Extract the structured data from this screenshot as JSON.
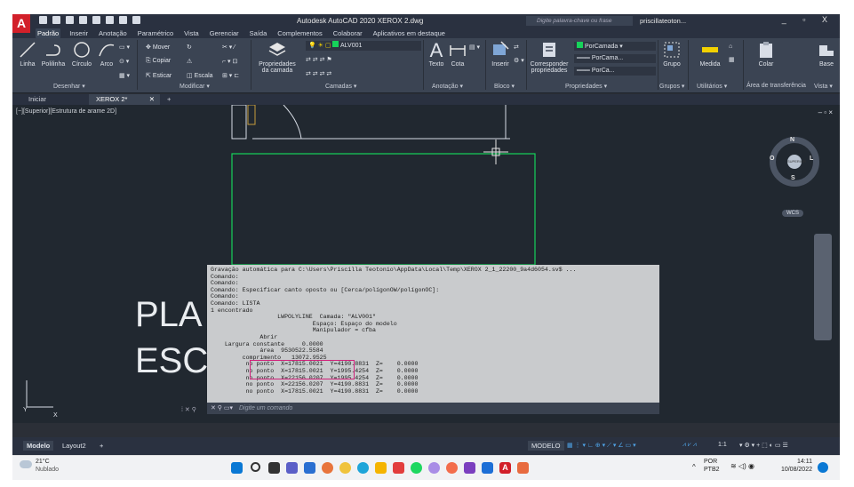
{
  "app": {
    "logo": "A",
    "title": "Autodesk AutoCAD 2020   XEROX 2.dwg"
  },
  "search": {
    "placeholder": "Digite palavra-chave ou frase"
  },
  "user": {
    "name": "priscillateoton..."
  },
  "window_controls": "_ ▫ X",
  "ribbon_tabs": [
    "Padrão",
    "Inserir",
    "Anotação",
    "Paramétrico",
    "Vista",
    "Gerenciar",
    "Saída",
    "Complementos",
    "Colaborar",
    "Aplicativos em destaque"
  ],
  "ribbon": {
    "draw": {
      "linha": "Linha",
      "polilinha": "Polilinha",
      "circulo": "Círculo",
      "arco": "Arco",
      "panel": "Desenhar ▾"
    },
    "modify": {
      "mover": "Mover",
      "copiar": "Copiar",
      "esticar": "Esticar",
      "escala": "Escala",
      "panel": "Modificar ▾"
    },
    "layers": {
      "props": "Propriedades",
      "props2": "da camada",
      "current": "ALV001",
      "panel": "Camadas ▾"
    },
    "annotation": {
      "texto": "Texto",
      "cota": "Cota",
      "panel": "Anotação ▾"
    },
    "block": {
      "inserir": "Inserir",
      "panel": "Bloco ▾"
    },
    "properties": {
      "match": "Corresponder",
      "match2": "propriedades",
      "byLayer": "PorCamada",
      "byLayer2": "PorCama...",
      "byLayer3": "PorCa...",
      "panel": "Propriedades ▾"
    },
    "groups": {
      "grupo": "Grupo",
      "panel": "Grupos ▾"
    },
    "utilities": {
      "medida": "Medida",
      "panel": "Utilitários ▾"
    },
    "clipboard": {
      "colar": "Colar",
      "panel": "Área de transferência"
    },
    "view": {
      "base": "Base",
      "panel": "Vista ▾"
    }
  },
  "file_tabs": [
    "Iniciar",
    "XEROX 2*"
  ],
  "viewport_label": "[−][Superior][Estrutura de arame 2D]",
  "viewport_controls": "– ▫ ×",
  "navcube": {
    "n": "N",
    "s": "S",
    "e": "L",
    "w": "O",
    "face": "SUPERIOR",
    "wcs": "WCS"
  },
  "canvas_text": [
    "PLA",
    "ESC"
  ],
  "ucs": {
    "x": "X",
    "y": "Y"
  },
  "command_lines": [
    "Gravação automática para C:\\Users\\Priscilla Teotonio\\AppData\\Local\\Temp\\XEROX 2_1_22200_9a4d6054.sv$ ...",
    "Comando:",
    "Comando:",
    "Comando: Especificar canto oposto ou [Cerca/polígonOW/polígonOC]:",
    "Comando:",
    "Comando: LISTA",
    "1 encontrado",
    "                   LWPOLYLINE  Camada: \"ALV001\"",
    "                             Espaço: Espaço do modelo",
    "                             Manipulador = cfba",
    "              Abrir",
    "    Largura constante     0.0000",
    "              área  9530522.5584",
    "         comprimento   13072.9525",
    "          no ponto  X=17815.0021  Y=4190.8831  Z=    0.0000",
    "          no ponto  X=17815.0021  Y=1995.4254  Z=    0.0000",
    "          no ponto  X=22156.0207  Y=1995.4254  Z=    0.0000",
    "          no ponto  X=22156.0207  Y=4190.8831  Z=    0.0000",
    "          no ponto  X=17815.0021  Y=4190.8831  Z=    0.0000"
  ],
  "command_prompt": {
    "placeholder": "Digite um comando"
  },
  "layout_tabs": [
    "Modelo",
    "Layout2",
    "+"
  ],
  "status": {
    "modelo": "MODELO",
    "scale": "1:1"
  },
  "taskbar": {
    "weather_temp": "21°C",
    "weather_desc": "Nublado",
    "lang1": "POR",
    "lang2": "PTB2",
    "time": "14:11",
    "date": "10/08/2022"
  }
}
